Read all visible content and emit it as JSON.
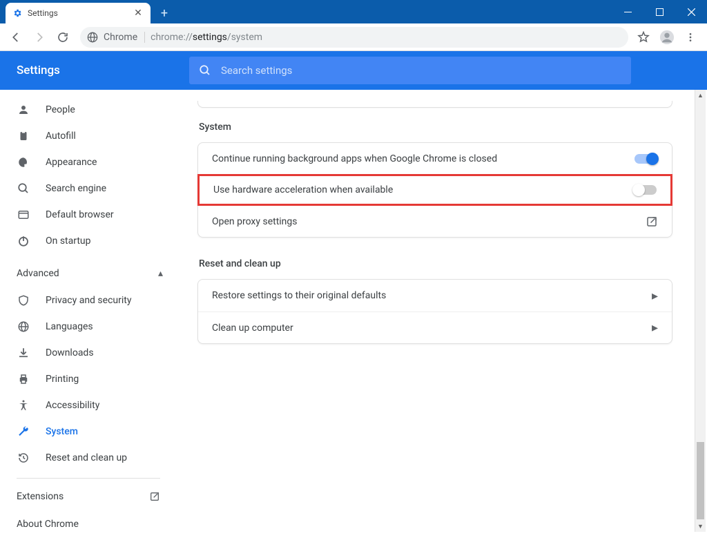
{
  "tab": {
    "title": "Settings"
  },
  "omnibox": {
    "label": "Chrome",
    "url_prefix": "chrome://",
    "url_mid": "settings",
    "url_suffix": "/system"
  },
  "header": {
    "title": "Settings"
  },
  "search": {
    "placeholder": "Search settings"
  },
  "sidebar": {
    "items": [
      {
        "label": "People"
      },
      {
        "label": "Autofill"
      },
      {
        "label": "Appearance"
      },
      {
        "label": "Search engine"
      },
      {
        "label": "Default browser"
      },
      {
        "label": "On startup"
      }
    ],
    "advanced_label": "Advanced",
    "adv_items": [
      {
        "label": "Privacy and security"
      },
      {
        "label": "Languages"
      },
      {
        "label": "Downloads"
      },
      {
        "label": "Printing"
      },
      {
        "label": "Accessibility"
      },
      {
        "label": "System"
      },
      {
        "label": "Reset and clean up"
      }
    ],
    "extensions_label": "Extensions",
    "about_label": "About Chrome"
  },
  "sections": {
    "system": {
      "title": "System",
      "rows": {
        "bg_apps": "Continue running background apps when Google Chrome is closed",
        "hw_accel": "Use hardware acceleration when available",
        "proxy": "Open proxy settings"
      }
    },
    "reset": {
      "title": "Reset and clean up",
      "rows": {
        "restore": "Restore settings to their original defaults",
        "cleanup": "Clean up computer"
      }
    }
  }
}
